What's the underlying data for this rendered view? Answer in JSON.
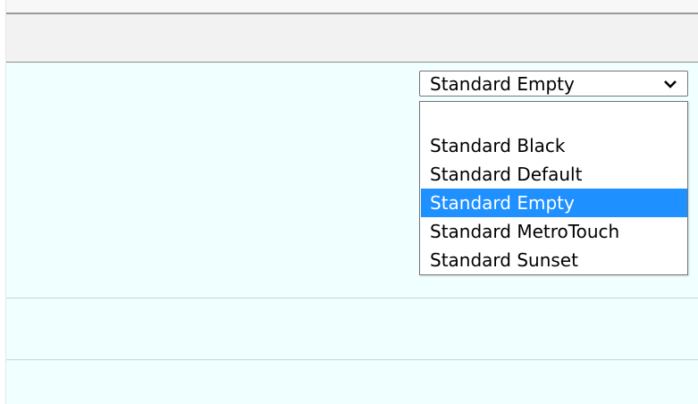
{
  "theme_select": {
    "selected_value": "Standard Empty",
    "options": [
      "",
      "Standard Black",
      "Standard Default",
      "Standard Empty",
      "Standard MetroTouch",
      "Standard Sunset"
    ],
    "highlight_color": "#1e90ff"
  },
  "colors": {
    "content_background": "#f0ffff",
    "toolbar_background": "#f2f2f2"
  }
}
